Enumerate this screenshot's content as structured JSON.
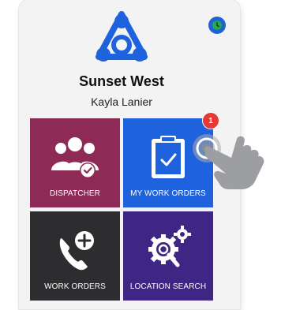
{
  "header": {
    "org_name": "Sunset West",
    "user_name": "Kayla Lanier",
    "clock_icon": "clock-icon",
    "logo_icon": "triangle-network-logo"
  },
  "tiles": [
    {
      "label": "DISPATCHER",
      "icon": "people-check-icon",
      "color": "#8d2a56"
    },
    {
      "label": "MY WORK ORDERS",
      "icon": "clipboard-check-icon",
      "color": "#1f62dd",
      "badge": "1"
    },
    {
      "label": "WORK ORDERS",
      "icon": "phone-plus-icon",
      "color": "#2d2d30"
    },
    {
      "label": "LOCATION SEARCH",
      "icon": "gears-search-icon",
      "color": "#3f2685"
    }
  ],
  "overlay": {
    "hand_icon": "tap-hand-icon"
  },
  "colors": {
    "accent": "#1e63d6",
    "badge": "#e53935"
  }
}
